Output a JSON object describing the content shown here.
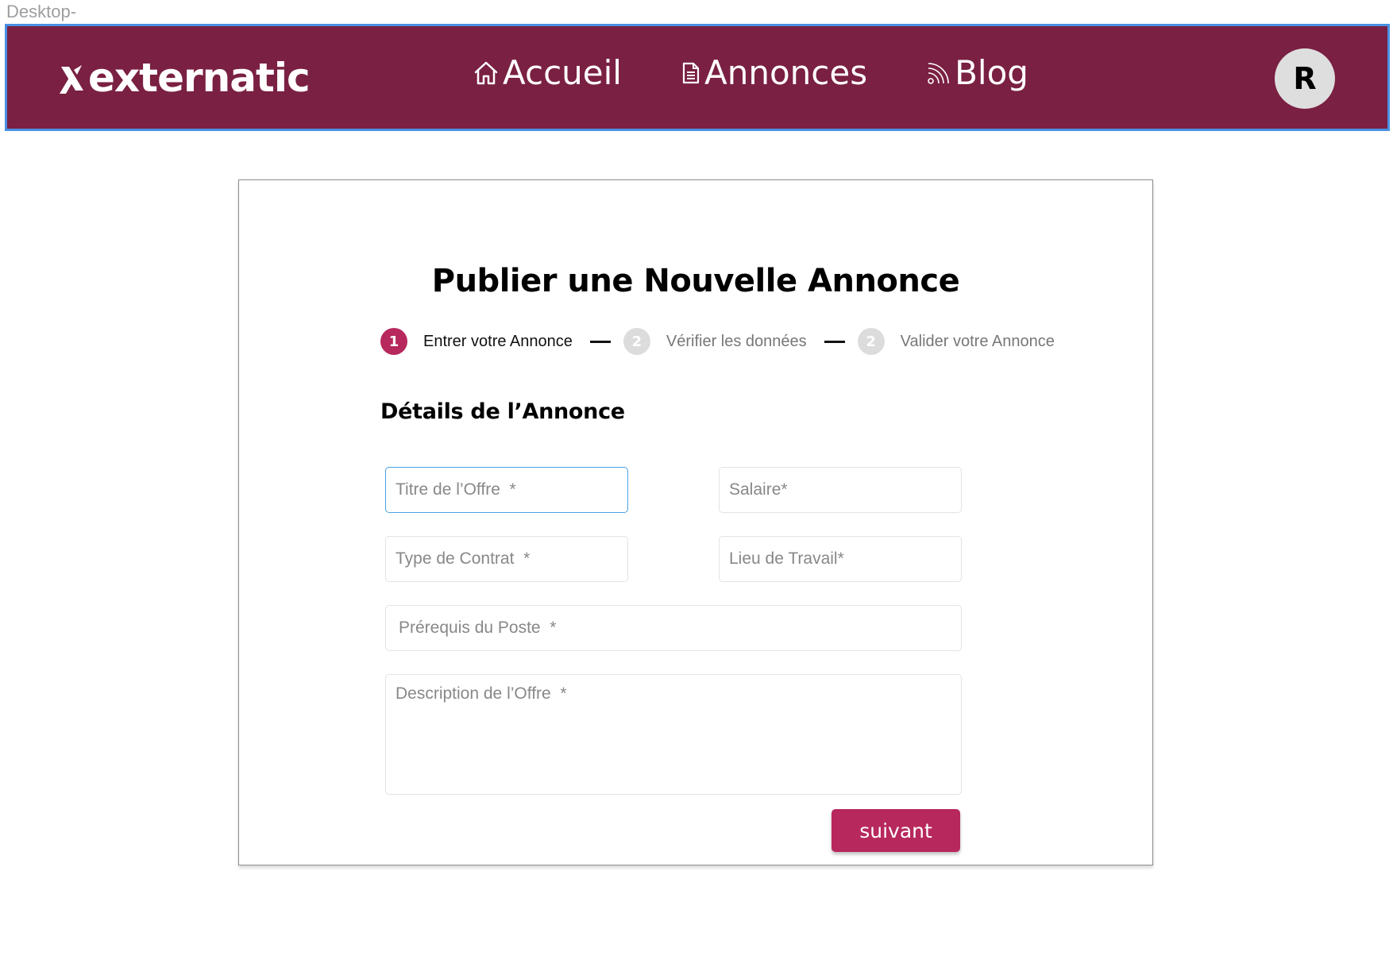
{
  "frame_label": "Desktop-",
  "header": {
    "logo_text": "externatic",
    "nav": [
      {
        "label": "Accueil",
        "icon": "home-icon"
      },
      {
        "label": "Annonces",
        "icon": "document-icon"
      },
      {
        "label": "Blog",
        "icon": "rss-icon"
      }
    ],
    "avatar_initial": "R",
    "colors": {
      "background": "#7a2042",
      "accent": "#b7285c"
    }
  },
  "form": {
    "title": "Publier une Nouvelle Annonce",
    "steps": [
      {
        "number": "1",
        "label": "Entrer votre Annonce",
        "active": true
      },
      {
        "number": "2",
        "label": "Vérifier les données",
        "active": false
      },
      {
        "number": "2",
        "label": "Valider votre Annonce",
        "active": false
      }
    ],
    "section_title": "Détails de l’Annonce",
    "fields": {
      "titre": {
        "placeholder": "Titre de l’Offre  *",
        "value": ""
      },
      "salaire": {
        "placeholder": "Salaire*",
        "value": ""
      },
      "contrat": {
        "placeholder": "Type de Contrat  *",
        "value": ""
      },
      "lieu": {
        "placeholder": "Lieu de Travail*",
        "value": ""
      },
      "prerequis": {
        "placeholder": "Prérequis du Poste  *",
        "value": ""
      },
      "description": {
        "placeholder": "Description de l’Offre  *",
        "value": ""
      }
    },
    "next_label": "suivant"
  }
}
